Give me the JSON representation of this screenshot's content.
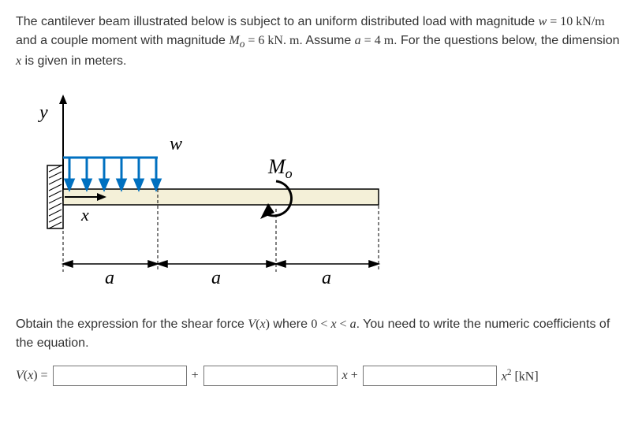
{
  "problem": {
    "text1": "The cantilever beam illustrated below is subject to an uniform distributed load with magnitude ",
    "w_eq": "w = 10 kN/m",
    "text2": " and a couple moment with magnitude ",
    "mo_eq": "Mₒ = 6 kN. m",
    "text3": ". Assume ",
    "a_eq": "a = 4 m",
    "text4": ". For the questions below, the dimension ",
    "x_sym": "x",
    "text5": " is given in meters."
  },
  "figure": {
    "y_label": "y",
    "w_label": "w",
    "mo_label": "M",
    "mo_sub": "o",
    "x_label": "x",
    "a_label": "a"
  },
  "instruction": {
    "text1": "Obtain the expression for the shear force ",
    "vx": "V(x)",
    "text2": " where ",
    "range": "0 < x < a",
    "text3": ". You need to write the numeric coefficients of the equation."
  },
  "answer": {
    "label": "V(x) = ",
    "plus1": "+",
    "xterm": "x +",
    "unit_pre": "x",
    "unit_exp": "2",
    "unit_post": " [kN]"
  }
}
